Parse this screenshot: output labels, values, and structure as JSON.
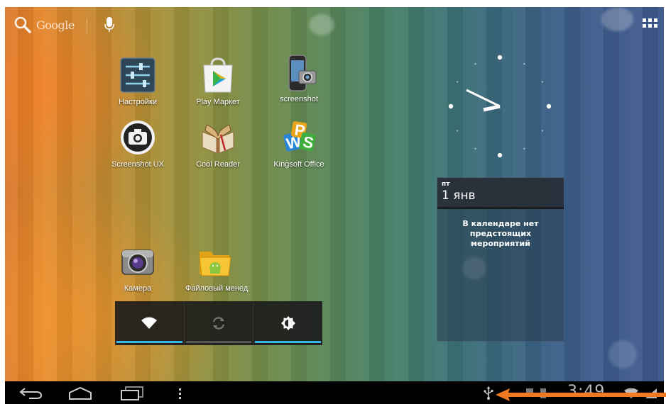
{
  "search": {
    "label": "Google",
    "icon": "search-icon"
  },
  "apps_button": {
    "icon": "all-apps-grid-icon"
  },
  "apps": [
    {
      "label": "Настройки",
      "icon": "settings-icon"
    },
    {
      "label": "Play Маркет",
      "icon": "play-store-icon"
    },
    {
      "label": "screenshot",
      "icon": "phone-camera-icon"
    },
    {
      "label": "Screenshot UX",
      "icon": "camera-circle-icon"
    },
    {
      "label": "Cool Reader",
      "icon": "book-icon"
    },
    {
      "label": "Kingsoft Office",
      "icon": "office-icon"
    },
    {
      "label": "Камера",
      "icon": "camera-icon"
    },
    {
      "label": "Файловый менеджер",
      "icon": "folder-icon"
    }
  ],
  "calendar": {
    "day_of_week": "пт",
    "date": "1 янв",
    "message": "В календаре нет предстоящих мероприятий"
  },
  "power_widget": {
    "buttons": [
      {
        "icon": "wifi-icon",
        "state": "on",
        "color": "#33b5e5"
      },
      {
        "icon": "sync-icon",
        "state": "off",
        "color": "#555555"
      },
      {
        "icon": "brightness-icon",
        "state": "on",
        "color": "#33b5e5"
      }
    ]
  },
  "navbar": {
    "buttons": [
      "back-icon",
      "home-icon",
      "recent-apps-icon",
      "menu-icon"
    ],
    "status": {
      "usb_icon": "usb-icon",
      "time": "3:49"
    }
  },
  "colors": {
    "accent": "#33b5e5",
    "arrow": "#f07a22",
    "navbar": "#000000"
  }
}
